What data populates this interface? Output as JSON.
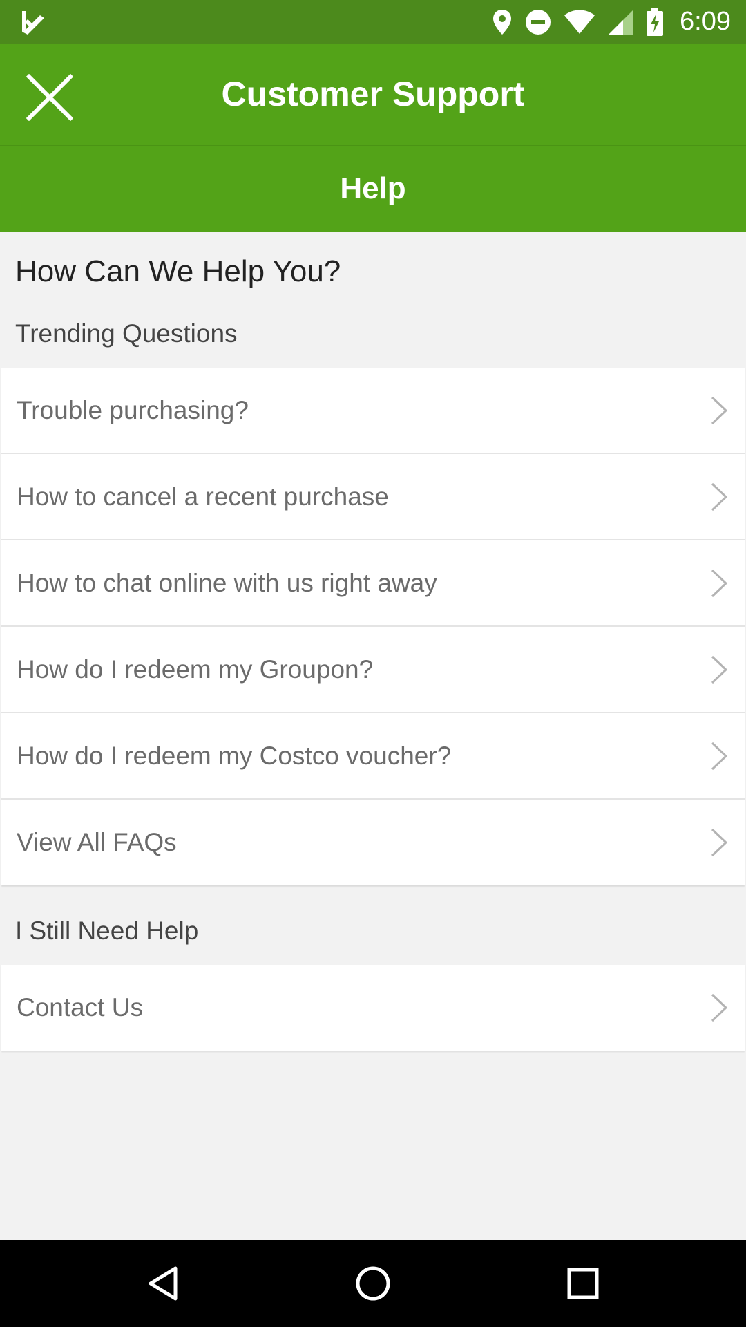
{
  "status_bar": {
    "time": "6:09",
    "icons": [
      "check-notification-icon",
      "location-icon",
      "do-not-disturb-icon",
      "wifi-icon",
      "cell-signal-icon",
      "battery-charging-icon"
    ],
    "color": "#4c8a1c"
  },
  "toolbar": {
    "title": "Customer Support",
    "close_icon": "close-icon",
    "color": "#53a318"
  },
  "tabs": {
    "active": "Help"
  },
  "main": {
    "heading": "How Can We Help You?",
    "trending_label": "Trending Questions",
    "trending_items": [
      {
        "label": "Trouble purchasing?"
      },
      {
        "label": "How to cancel a recent purchase"
      },
      {
        "label": "How to chat online with us right away"
      },
      {
        "label": "How do I redeem my Groupon?"
      },
      {
        "label": "How do I redeem my Costco voucher?"
      },
      {
        "label": "View All FAQs"
      }
    ],
    "still_need_label": "I Still Need Help",
    "contact_items": [
      {
        "label": "Contact Us"
      }
    ]
  },
  "nav_bar": {
    "buttons": [
      "back-icon",
      "home-icon",
      "recents-icon"
    ]
  }
}
